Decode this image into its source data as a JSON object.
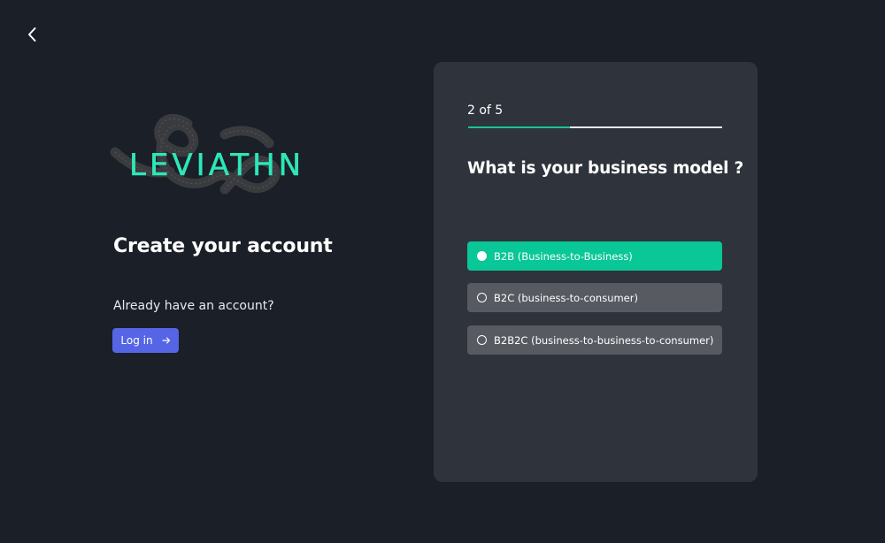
{
  "nav": {
    "back_icon": "chevron-left-icon"
  },
  "brand": {
    "logo_text": "LEVIATHN",
    "accent_color": "#17c49a"
  },
  "left_panel": {
    "title": "Create your account",
    "prompt": "Already have an account?",
    "login_label": "Log in",
    "login_icon": "arrow-right-icon",
    "login_color": "#5565e6"
  },
  "wizard": {
    "step_label": "2 of 5",
    "progress": 0.4,
    "question": "What is your business model ?",
    "selected_color": "#09c797",
    "options": [
      {
        "label": "B2B (Business-to-Business)",
        "selected": true
      },
      {
        "label": "B2C (business-to-consumer)",
        "selected": false
      },
      {
        "label": "B2B2C (business-to-business-to-consumer)",
        "selected": false
      }
    ]
  }
}
